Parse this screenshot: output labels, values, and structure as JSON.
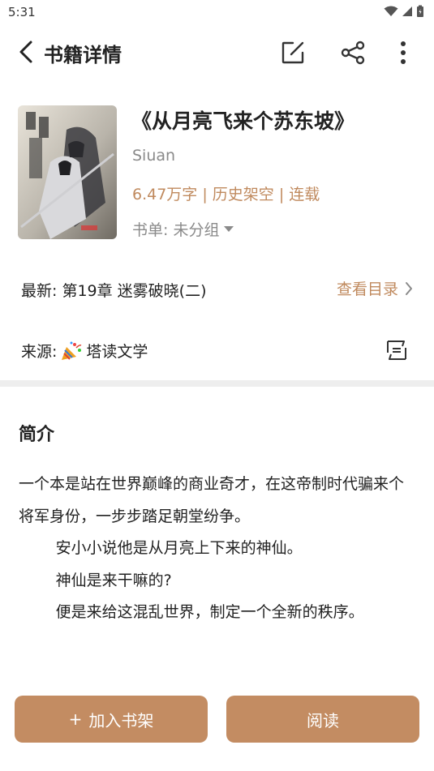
{
  "status_bar": {
    "time": "5:31"
  },
  "app_bar": {
    "title": "书籍详情"
  },
  "book": {
    "title": "《从月亮飞来个苏东坡》",
    "author": "Siuan",
    "meta": "6.47万字 | 历史架空 | 连载",
    "shelf": "书单: 未分组"
  },
  "latest": {
    "chapter": "最新: 第19章 迷雾破晓(二)",
    "toc_label": "查看目录"
  },
  "source": {
    "prefix": "来源:",
    "name": "塔读文学"
  },
  "intro": {
    "heading": "简介",
    "paragraphs": [
      "一个本是站在世界巅峰的商业奇才，在这帝制时代骗来个将军身份，一步步踏足朝堂纷争。",
      "安小小说他是从月亮上下来的神仙。",
      "神仙是来干嘛的?",
      "便是来给这混乱世界，制定一个全新的秩序。"
    ]
  },
  "actions": {
    "add_icon": "+",
    "add_label": "加入书架",
    "read_label": "阅读"
  },
  "colors": {
    "accent": "#c08a5e",
    "button_bg": "#c38c62",
    "muted_text": "#8a8a8a"
  },
  "icons": {
    "back": "chevron-left-icon",
    "edit": "edit-icon",
    "share": "share-icon",
    "more": "more-vertical-icon",
    "dropdown": "caret-down-icon",
    "toc_arrow": "chevron-right-icon",
    "source": "party-popper-icon",
    "switch_source": "switch-source-icon"
  }
}
